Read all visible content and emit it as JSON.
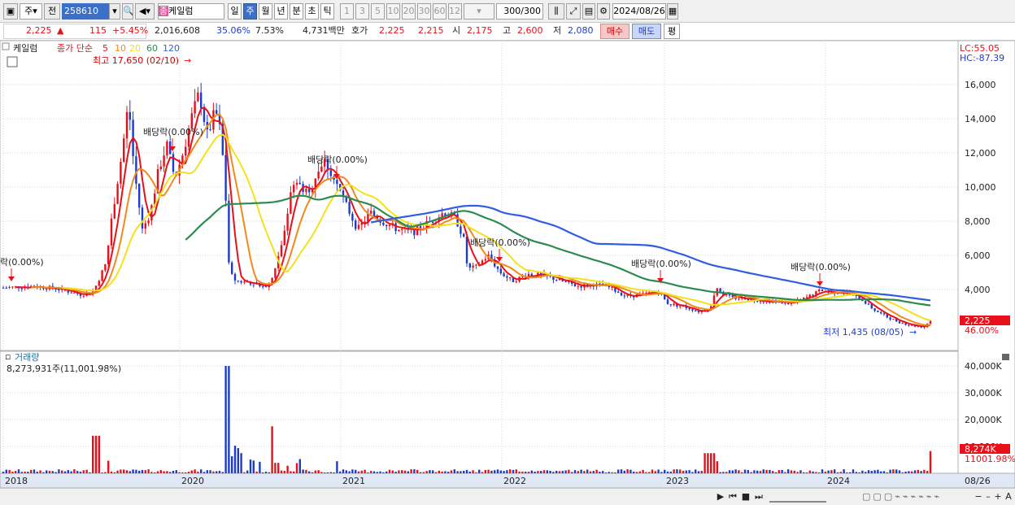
{
  "toolbar": {
    "period_type": "주",
    "prev_label": "전",
    "code": "258610",
    "name": "케일럼",
    "name_badge": "종",
    "periods": [
      "일",
      "주",
      "월",
      "년",
      "분",
      "초",
      "틱"
    ],
    "selected_period": "주",
    "numbers": [
      "1",
      "3",
      "5",
      "10",
      "20",
      "30",
      "60",
      "120"
    ],
    "count_value": "300",
    "count_total": "/300",
    "date": "2024/08/26"
  },
  "quote": {
    "price": "2,225",
    "change_arrow": "▲",
    "change": "115",
    "change_pct": "+5.45%",
    "volume": "2,016,608",
    "turnover_pct": "35.06%",
    "other_pct": "7.53%",
    "amount": "4,731백만",
    "hoga_label": "호가",
    "ask": "2,225",
    "bid": "2,215",
    "open_label": "시",
    "open": "2,175",
    "high_label": "고",
    "high": "2,600",
    "low_label": "저",
    "low": "2,080",
    "buy_label": "매수",
    "sell_label": "매도",
    "avg_label": "평"
  },
  "price_panel": {
    "stock_label": "케일럼",
    "legend_prefix": "종가 단순",
    "ma_periods": [
      "5",
      "10",
      "20",
      "60",
      "120"
    ],
    "ma_colors": [
      "#e8101a",
      "#f08a1c",
      "#f2e21c",
      "#2e8b4f",
      "#2f5ee0"
    ],
    "lc_label": "LC:55.05",
    "hc_label": "HC:-87.39",
    "max_label": "최고 17,650 (02/10)",
    "min_label": "최저 1,435 (08/05)",
    "current_price_tag": "2,225",
    "current_pct_tag": "46.00%",
    "dividend_labels": [
      "락(0.00%)",
      "배당락(0.00%)",
      "배당락(0.00%)",
      "배당락(0.00%)",
      "배당락(0.00%)",
      "배당락(0.00%)"
    ],
    "y_ticks": [
      "16,000",
      "14,000",
      "12,000",
      "10,000",
      "8,000",
      "6,000",
      "4,000"
    ]
  },
  "volume_panel": {
    "title": "거래량",
    "value_label": "8,273,931주(11,001.98%)",
    "y_ticks": [
      "40,000K",
      "30,000K",
      "20,000K",
      "10,000K"
    ],
    "current_tag": "8,274K",
    "pct_tag": "11001.98%"
  },
  "x_axis": {
    "labels": [
      "2018",
      "2020",
      "2021",
      "2022",
      "2023",
      "2024"
    ],
    "right_label": "08/26"
  },
  "chart_data": {
    "type": "candlestick",
    "x_unit": "weekly",
    "price_ma_summary": [
      {
        "date": "2018",
        "price": 4000
      },
      {
        "date": "2019 mid",
        "price": 15000
      },
      {
        "date": "2020-02",
        "price": 17650
      },
      {
        "date": "2020 mid",
        "price": 4200
      },
      {
        "date": "2021-01",
        "price": 10500
      },
      {
        "date": "2022-01",
        "price": 8200
      },
      {
        "date": "2023-01",
        "price": 3000
      },
      {
        "date": "2024-08-05",
        "price": 1435
      },
      {
        "date": "2024-08-26",
        "price": 2225
      }
    ],
    "y_range": [
      1000,
      17000
    ],
    "volume_range_k": [
      0,
      42000
    ]
  }
}
